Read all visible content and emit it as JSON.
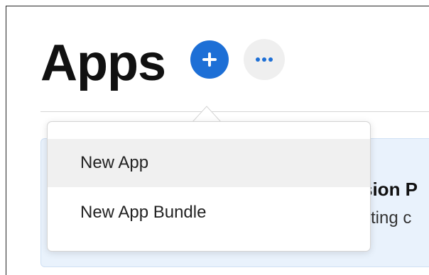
{
  "page": {
    "title": "Apps"
  },
  "toolbar": {
    "add_icon": "plus-circle-icon",
    "more_icon": "ellipsis-icon",
    "add_color": "#1d6fd6",
    "more_background": "#efefef"
  },
  "card": {
    "title_fragment": "sion P",
    "text_fragment": "sting c",
    "background": "#e9f2fc"
  },
  "menu": {
    "items": [
      {
        "label": "New App",
        "highlighted": true
      },
      {
        "label": "New App Bundle",
        "highlighted": false
      }
    ]
  }
}
